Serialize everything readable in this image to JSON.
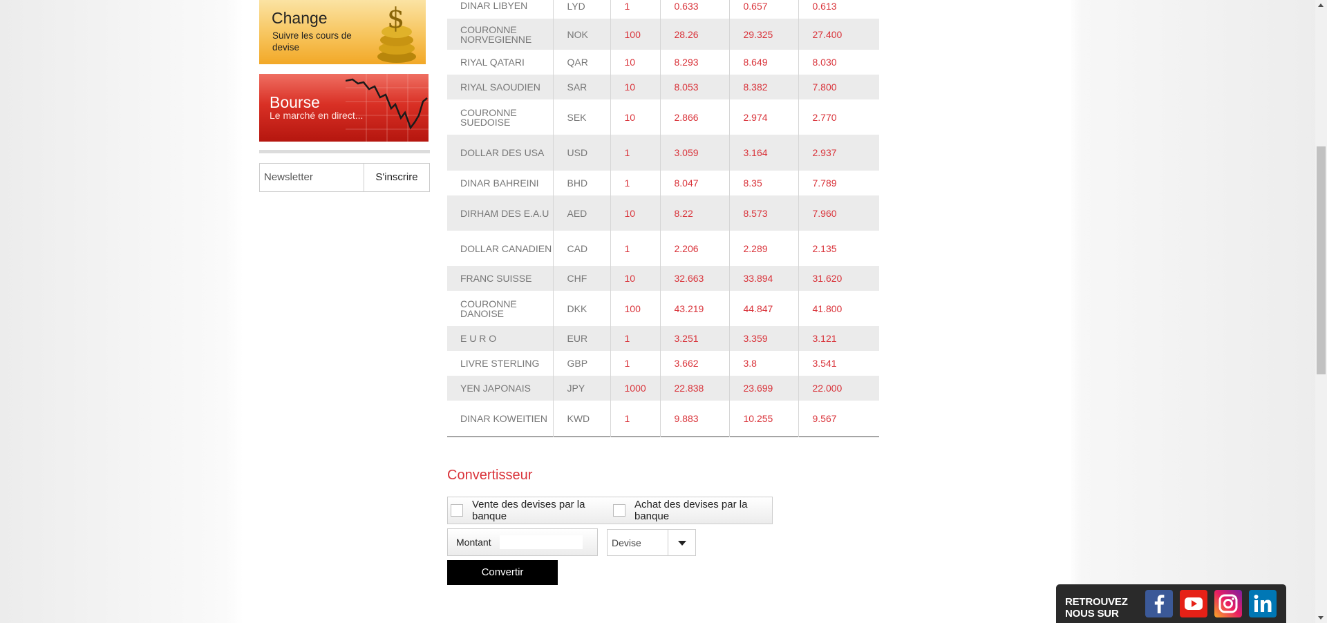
{
  "sidebar": {
    "change_banner": {
      "title": "Change",
      "subtitle": "Suivre les cours de devise"
    },
    "bourse_banner": {
      "title": "Bourse",
      "subtitle": "Le marché en direct..."
    },
    "newsletter": {
      "placeholder": "Newsletter",
      "button": "S'inscrire"
    }
  },
  "rates_table": {
    "rows": [
      {
        "name": "DINAR LIBYEN",
        "code": "LYD",
        "unit": "1",
        "v1": "0.633",
        "v2": "0.657",
        "v3": "0.613"
      },
      {
        "name": "COURONNE NORVEGIENNE",
        "code": "NOK",
        "unit": "100",
        "v1": "28.26",
        "v2": "29.325",
        "v3": "27.400"
      },
      {
        "name": "RIYAL QATARI",
        "code": "QAR",
        "unit": "10",
        "v1": "8.293",
        "v2": "8.649",
        "v3": "8.030"
      },
      {
        "name": "RIYAL SAOUDIEN",
        "code": "SAR",
        "unit": "10",
        "v1": "8.053",
        "v2": "8.382",
        "v3": "7.800"
      },
      {
        "name": "COURONNE SUEDOISE",
        "code": "SEK",
        "unit": "10",
        "v1": "2.866",
        "v2": "2.974",
        "v3": "2.770"
      },
      {
        "name": "DOLLAR DES USA",
        "code": "USD",
        "unit": "1",
        "v1": "3.059",
        "v2": "3.164",
        "v3": "2.937"
      },
      {
        "name": "DINAR BAHREINI",
        "code": "BHD",
        "unit": "1",
        "v1": "8.047",
        "v2": "8.35",
        "v3": "7.789"
      },
      {
        "name": "DIRHAM DES E.A.U",
        "code": "AED",
        "unit": "10",
        "v1": "8.22",
        "v2": "8.573",
        "v3": "7.960"
      },
      {
        "name": "DOLLAR CANADIEN",
        "code": "CAD",
        "unit": "1",
        "v1": "2.206",
        "v2": "2.289",
        "v3": "2.135"
      },
      {
        "name": "FRANC SUISSE",
        "code": "CHF",
        "unit": "10",
        "v1": "32.663",
        "v2": "33.894",
        "v3": "31.620"
      },
      {
        "name": "COURONNE DANOISE",
        "code": "DKK",
        "unit": "100",
        "v1": "43.219",
        "v2": "44.847",
        "v3": "41.800"
      },
      {
        "name": "E U R O",
        "code": "EUR",
        "unit": "1",
        "v1": "3.251",
        "v2": "3.359",
        "v3": "3.121"
      },
      {
        "name": "LIVRE STERLING",
        "code": "GBP",
        "unit": "1",
        "v1": "3.662",
        "v2": "3.8",
        "v3": "3.541"
      },
      {
        "name": "YEN JAPONAIS",
        "code": "JPY",
        "unit": "1000",
        "v1": "22.838",
        "v2": "23.699",
        "v3": "22.000"
      },
      {
        "name": "DINAR KOWEITIEN",
        "code": "KWD",
        "unit": "1",
        "v1": "9.883",
        "v2": "10.255",
        "v3": "9.567"
      }
    ]
  },
  "converter": {
    "title": "Convertisseur",
    "option_sell": "Vente des devises par la banque",
    "option_buy": "Achat des devises par la banque",
    "amount_label": "Montant",
    "amount_value": "",
    "currency_placeholder": "Devise",
    "convert_button": "Convertir"
  },
  "social": {
    "label": "RETROUVEZ NOUS SUR",
    "icons": [
      "facebook-icon",
      "youtube-icon",
      "instagram-icon",
      "linkedin-icon"
    ]
  },
  "colors": {
    "accent": "#d9333a",
    "dark": "#000000"
  }
}
